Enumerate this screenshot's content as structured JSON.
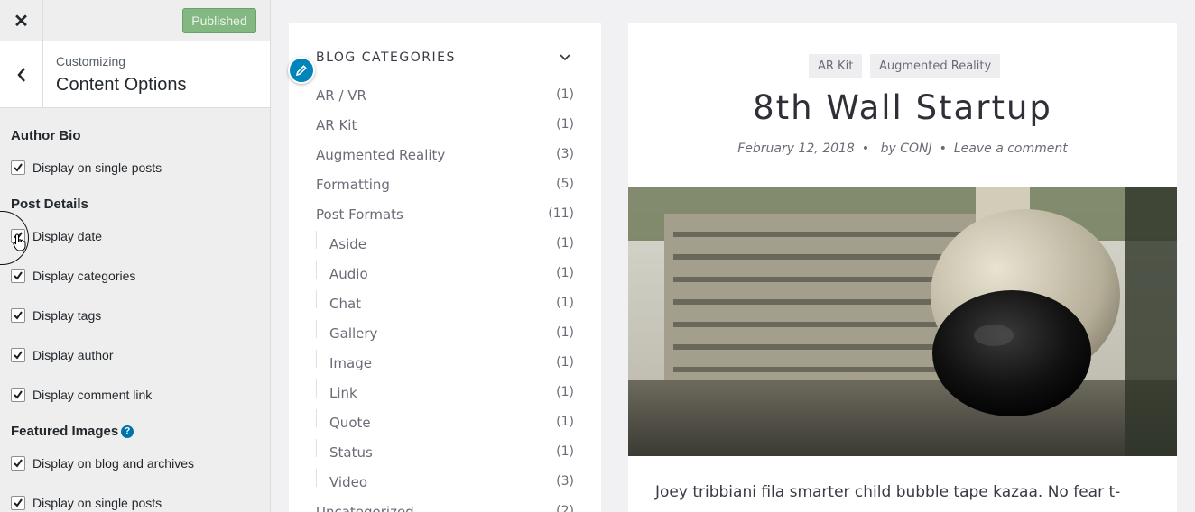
{
  "header": {
    "close_icon": "close-icon",
    "publish_label": "Published"
  },
  "section": {
    "customizing_label": "Customizing",
    "title": "Content Options"
  },
  "options": {
    "author_bio": {
      "heading": "Author Bio",
      "items": [
        {
          "label": "Display on single posts",
          "checked": true
        }
      ]
    },
    "post_details": {
      "heading": "Post Details",
      "items": [
        {
          "label": "Display date",
          "checked": true
        },
        {
          "label": "Display categories",
          "checked": true
        },
        {
          "label": "Display tags",
          "checked": true
        },
        {
          "label": "Display author",
          "checked": true
        },
        {
          "label": "Display comment link",
          "checked": true
        }
      ]
    },
    "featured_images": {
      "heading": "Featured Images",
      "help_icon": "?",
      "items": [
        {
          "label": "Display on blog and archives",
          "checked": true
        },
        {
          "label": "Display on single posts",
          "checked": true
        }
      ]
    }
  },
  "widget": {
    "title": "BLOG CATEGORIES",
    "categories": [
      {
        "name": "AR / VR",
        "count": "(1)",
        "child": false
      },
      {
        "name": "AR Kit",
        "count": "(1)",
        "child": false
      },
      {
        "name": "Augmented Reality",
        "count": "(3)",
        "child": false
      },
      {
        "name": "Formatting",
        "count": "(5)",
        "child": false
      },
      {
        "name": "Post Formats",
        "count": "(11)",
        "child": false
      },
      {
        "name": "Aside",
        "count": "(1)",
        "child": true
      },
      {
        "name": "Audio",
        "count": "(1)",
        "child": true
      },
      {
        "name": "Chat",
        "count": "(1)",
        "child": true
      },
      {
        "name": "Gallery",
        "count": "(1)",
        "child": true
      },
      {
        "name": "Image",
        "count": "(1)",
        "child": true
      },
      {
        "name": "Link",
        "count": "(1)",
        "child": true
      },
      {
        "name": "Quote",
        "count": "(1)",
        "child": true
      },
      {
        "name": "Status",
        "count": "(1)",
        "child": true
      },
      {
        "name": "Video",
        "count": "(3)",
        "child": true
      },
      {
        "name": "Uncategorized",
        "count": "(2)",
        "child": false
      }
    ]
  },
  "article": {
    "tags": [
      "AR Kit",
      "Augmented Reality"
    ],
    "title": "8th Wall Startup",
    "date": "February 12, 2018",
    "by": "by",
    "author": "CONJ",
    "comment_link": "Leave a comment",
    "meta_separator": "•",
    "excerpt": "Joey tribbiani fila smarter child bubble tape kazaa. No fear t-"
  },
  "colors": {
    "accent": "#0085ba",
    "publish_button": "#84b883"
  }
}
